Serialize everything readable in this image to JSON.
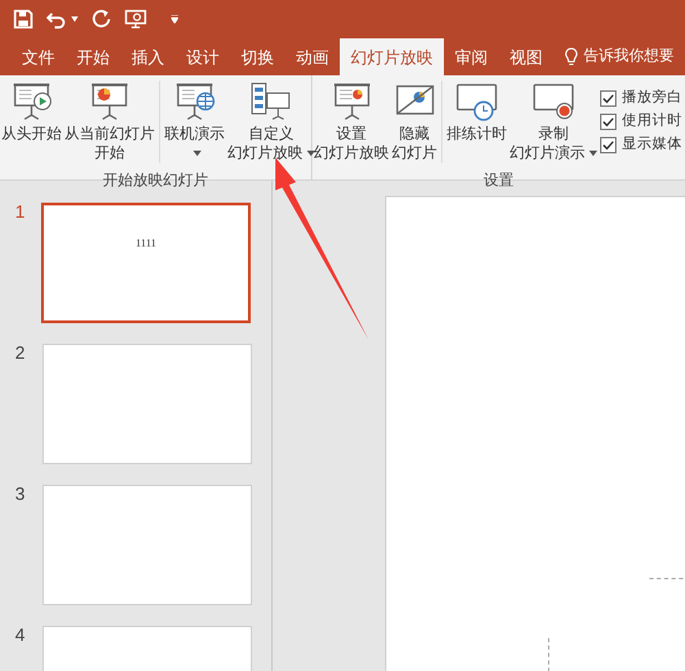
{
  "tabs": [
    {
      "label": "文件",
      "selected": false
    },
    {
      "label": "开始",
      "selected": false
    },
    {
      "label": "插入",
      "selected": false
    },
    {
      "label": "设计",
      "selected": false
    },
    {
      "label": "切换",
      "selected": false
    },
    {
      "label": "动画",
      "selected": false
    },
    {
      "label": "幻灯片放映",
      "selected": true
    },
    {
      "label": "审阅",
      "selected": false
    },
    {
      "label": "视图",
      "selected": false
    }
  ],
  "tell_me": "告诉我你想要",
  "ribbon": {
    "groups": [
      {
        "label": "开始放映幻灯片",
        "buttons": [
          {
            "kind": "from-start",
            "lines": [
              "从头开始"
            ],
            "dropdown": false
          },
          {
            "kind": "from-current",
            "lines": [
              "从当前幻灯片",
              "开始"
            ],
            "dropdown": false
          },
          {
            "kind": "online",
            "lines": [
              "联机演示"
            ],
            "dropdown": true
          },
          {
            "kind": "custom",
            "lines": [
              "自定义",
              "幻灯片放映"
            ],
            "dropdown": true
          }
        ]
      },
      {
        "label": "设置",
        "buttons": [
          {
            "kind": "setup",
            "lines": [
              "设置",
              "幻灯片放映"
            ],
            "dropdown": false
          },
          {
            "kind": "hide",
            "lines": [
              "隐藏",
              "幻灯片"
            ],
            "dropdown": false
          },
          {
            "kind": "rehearse",
            "lines": [
              "排练计时"
            ],
            "dropdown": false
          },
          {
            "kind": "record",
            "lines": [
              "录制",
              "幻灯片演示"
            ],
            "dropdown": true
          }
        ],
        "checkboxes": [
          {
            "label": "播放旁白",
            "checked": true
          },
          {
            "label": "使用计时",
            "checked": true
          },
          {
            "label": "显示媒体",
            "checked": true
          }
        ]
      }
    ]
  },
  "slides": [
    {
      "number": "1",
      "selected": true,
      "text": "1111"
    },
    {
      "number": "2",
      "selected": false
    },
    {
      "number": "3",
      "selected": false
    },
    {
      "number": "4",
      "selected": false
    }
  ]
}
